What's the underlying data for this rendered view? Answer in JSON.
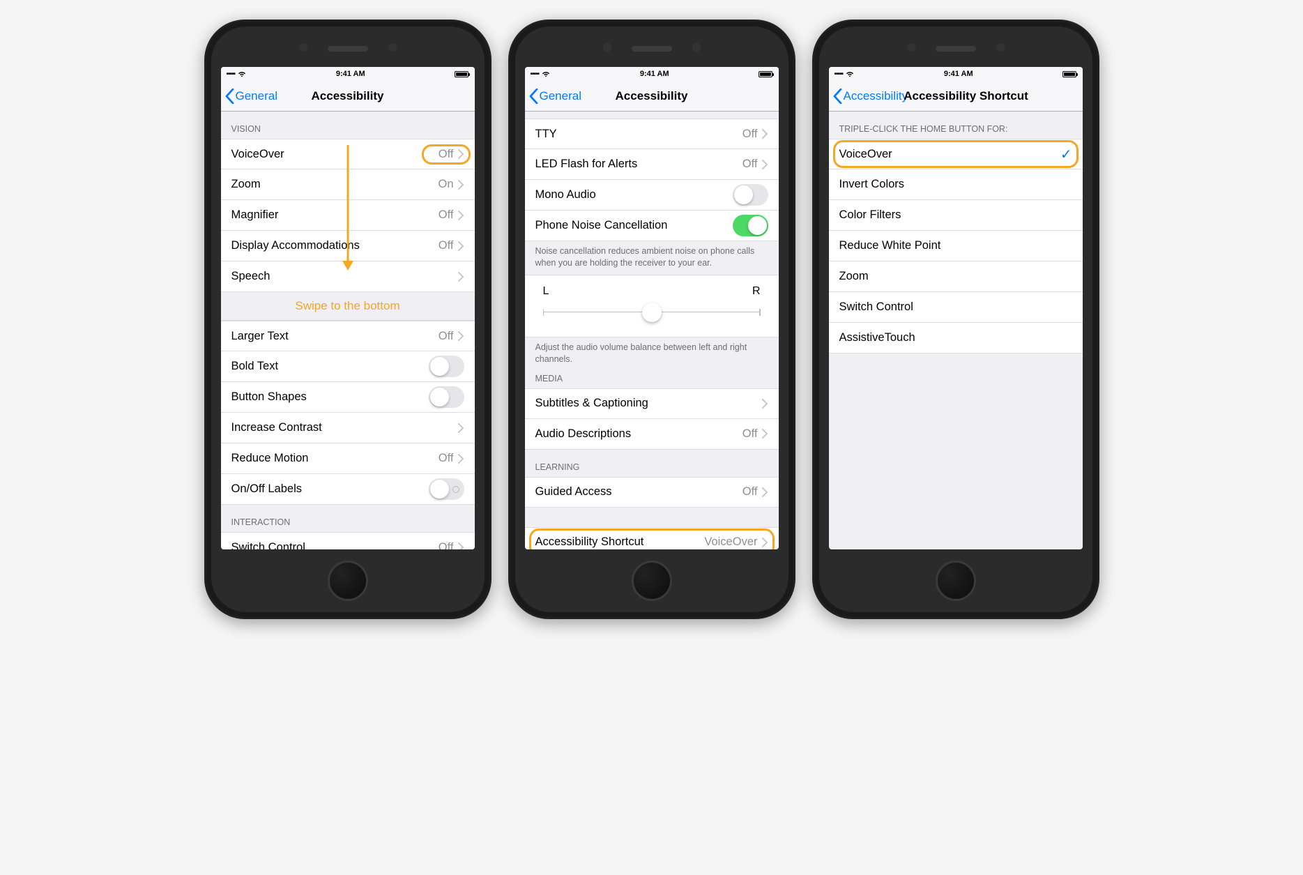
{
  "status": {
    "signal": "•••••",
    "time": "9:41 AM"
  },
  "phone1": {
    "back": "General",
    "title": "Accessibility",
    "swipe_note": "Swipe to the bottom",
    "section_vision": "VISION",
    "section_interaction": "INTERACTION",
    "rows": {
      "voiceover": {
        "label": "VoiceOver",
        "value": "Off"
      },
      "zoom": {
        "label": "Zoom",
        "value": "On"
      },
      "magnifier": {
        "label": "Magnifier",
        "value": "Off"
      },
      "display_acc": {
        "label": "Display Accommodations",
        "value": "Off"
      },
      "speech": {
        "label": "Speech"
      },
      "larger_text": {
        "label": "Larger Text",
        "value": "Off"
      },
      "bold_text": {
        "label": "Bold Text"
      },
      "button_shapes": {
        "label": "Button Shapes"
      },
      "increase_contrast": {
        "label": "Increase Contrast"
      },
      "reduce_motion": {
        "label": "Reduce Motion",
        "value": "Off"
      },
      "onoff_labels": {
        "label": "On/Off Labels"
      },
      "switch_control": {
        "label": "Switch Control",
        "value": "Off"
      }
    }
  },
  "phone2": {
    "back": "General",
    "title": "Accessibility",
    "section_media": "MEDIA",
    "section_learning": "LEARNING",
    "noise_footer": "Noise cancellation reduces ambient noise on phone calls when you are holding the receiver to your ear.",
    "slider_footer": "Adjust the audio volume balance between left and right channels.",
    "slider": {
      "left": "L",
      "right": "R",
      "value": 50
    },
    "rows": {
      "tty": {
        "label": "TTY",
        "value": "Off"
      },
      "led": {
        "label": "LED Flash for Alerts",
        "value": "Off"
      },
      "mono": {
        "label": "Mono Audio"
      },
      "noise": {
        "label": "Phone Noise Cancellation"
      },
      "subtitles": {
        "label": "Subtitles & Captioning"
      },
      "audio_desc": {
        "label": "Audio Descriptions",
        "value": "Off"
      },
      "guided": {
        "label": "Guided Access",
        "value": "Off"
      },
      "shortcut": {
        "label": "Accessibility Shortcut",
        "value": "VoiceOver"
      }
    }
  },
  "phone3": {
    "back": "Accessibility",
    "title": "Accessibility Shortcut",
    "section_header": "TRIPLE-CLICK THE HOME BUTTON FOR:",
    "options": {
      "voiceover": "VoiceOver",
      "invert": "Invert Colors",
      "filters": "Color Filters",
      "reduce_white": "Reduce White Point",
      "zoom": "Zoom",
      "switch": "Switch Control",
      "assistive": "AssistiveTouch"
    }
  }
}
